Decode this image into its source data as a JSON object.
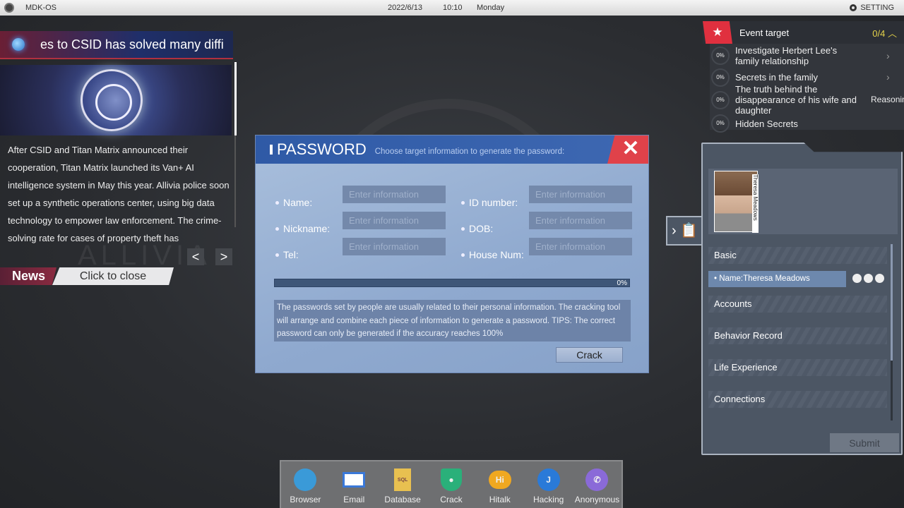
{
  "topbar": {
    "os_name": "MDK-OS",
    "date": "2022/6/13",
    "time": "10:10",
    "day": "Monday",
    "setting": "SETTING"
  },
  "news": {
    "ticker": "es to CSID has solved many diffi",
    "body": "After CSID and Titan Matrix announced their cooperation, Titan Matrix launched its Van+ AI intelligence system in May this year. Allivia police soon set up a synthetic operations center, using big data technology to empower law enforcement. The crime-solving rate for cases of property theft has",
    "prev": "<",
    "next": ">",
    "label": "News",
    "close": "Click to close",
    "bg_word": "ALLIVIA"
  },
  "password_dialog": {
    "title": "PASSWORD",
    "subtitle": "Choose target information to generate the password:",
    "close": "✕",
    "fields": [
      {
        "label": "Name:",
        "placeholder": "Enter information"
      },
      {
        "label": "ID number:",
        "placeholder": "Enter information"
      },
      {
        "label": "Nickname:",
        "placeholder": "Enter information"
      },
      {
        "label": "DOB:",
        "placeholder": "Enter information"
      },
      {
        "label": "Tel:",
        "placeholder": "Enter information"
      },
      {
        "label": "House Num:",
        "placeholder": "Enter information"
      }
    ],
    "progress_percent": 0,
    "progress_label": "0%",
    "tip": "The passwords set by people are usually related to their personal information. The cracking tool will arrange and combine each piece of information to generate a password. TIPS: The correct password can only be generated if the accuracy reaches 100%",
    "crack_button": "Crack"
  },
  "event_target": {
    "title": "Event target",
    "count": "0/4",
    "items": [
      {
        "progress": "0%",
        "text": "Investigate Herbert Lee's family relationship"
      },
      {
        "progress": "0%",
        "text": "Secrets in the family"
      },
      {
        "progress": "0%",
        "text": "The truth behind the disappearance of his wife and daughter",
        "tag": "Reasoning"
      },
      {
        "progress": "0%",
        "text": "Hidden Secrets"
      }
    ]
  },
  "dossier": {
    "person_name": "Theresa Meadows",
    "sections": [
      "Basic",
      "Accounts",
      "Behavior Record",
      "Life Experience",
      "Connections"
    ],
    "name_entry": "• Name:Theresa Meadows",
    "submit": "Submit"
  },
  "dock": {
    "apps": [
      {
        "label": "Browser",
        "icon": "globe-icon",
        "color": "#3a9ad8"
      },
      {
        "label": "Email",
        "icon": "envelope-icon",
        "color": "#3a78d8"
      },
      {
        "label": "Database",
        "icon": "sql-file-icon",
        "color": "#e8c050"
      },
      {
        "label": "Crack",
        "icon": "shield-key-icon",
        "color": "#2ab07a"
      },
      {
        "label": "Hitalk",
        "icon": "chat-bubble-icon",
        "color": "#f0a820"
      },
      {
        "label": "Hacking",
        "icon": "hook-icon",
        "color": "#2a7ad8"
      },
      {
        "label": "Anonymous",
        "icon": "phone-icon",
        "color": "#8a6ad8"
      }
    ]
  }
}
